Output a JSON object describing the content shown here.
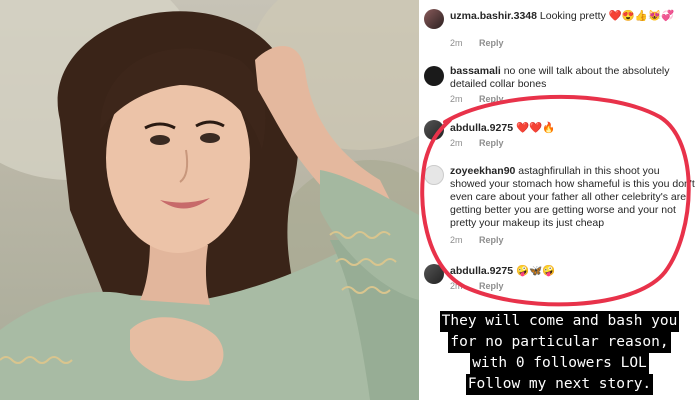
{
  "comments": [
    {
      "username": "uzma.bashir.3348",
      "text": "Looking pretty",
      "emoji": "❤️😍👍😻💞",
      "time": "2m",
      "reply": "Reply"
    },
    {
      "username": "bassamali",
      "text": "no one will talk about the absolutely detailed collar bones",
      "emoji": "",
      "time": "2m",
      "reply": "Reply"
    },
    {
      "username": "abdulla.9275",
      "text": "",
      "emoji": "❤️❤️🔥",
      "time": "2m",
      "reply": "Reply"
    },
    {
      "username": "zoyeekhan90",
      "text": "astaghfirullah in this shoot you showed your stomach how shameful is this you don't even care about your father all other celebrity's are getting better you are getting worse and your not pretty your makeup its just cheap",
      "emoji": "",
      "time": "2m",
      "reply": "Reply"
    },
    {
      "username": "abdulla.9275",
      "text": "",
      "emoji": "🤪🦋🤪",
      "time": "2m",
      "reply": "Reply"
    }
  ],
  "caption": [
    "They will come and bash you",
    "for no particular reason,",
    "with 0 followers LOL",
    "Follow my next story."
  ],
  "colors": {
    "highlight": "#e8324a",
    "caption_bg": "#000000",
    "meta_text": "#8e8e8e"
  }
}
